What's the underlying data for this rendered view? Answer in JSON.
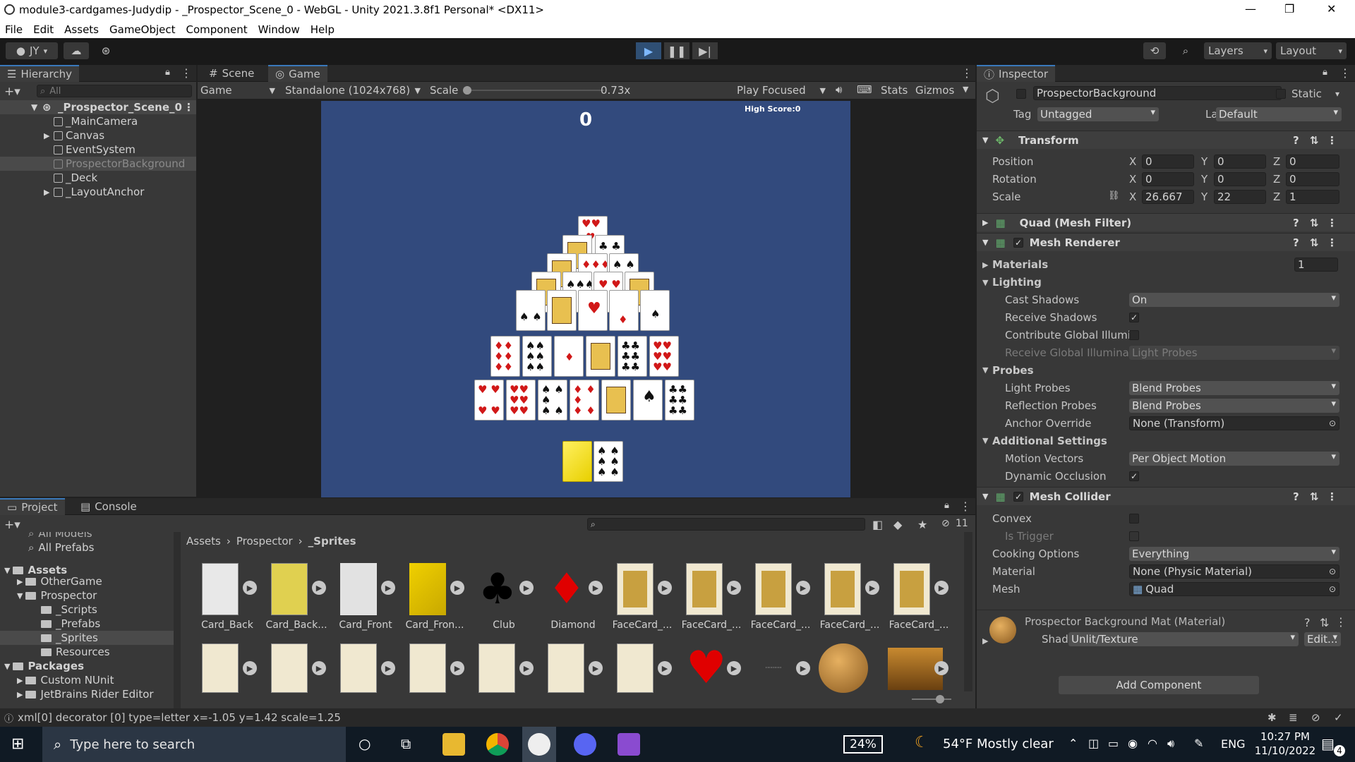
{
  "window": {
    "title": "module3-cardgames-Judydip - _Prospector_Scene_0 - WebGL - Unity 2021.3.8f1 Personal* <DX11>",
    "minimize": "—",
    "restore": "❐",
    "close": "✕"
  },
  "menu": [
    "File",
    "Edit",
    "Assets",
    "GameObject",
    "Component",
    "Window",
    "Help"
  ],
  "toolbar": {
    "account": "JY",
    "layers": "Layers",
    "layout": "Layout"
  },
  "hierarchy": {
    "tab": "Hierarchy",
    "search_placeholder": "All",
    "scene": "_Prospector_Scene_0",
    "items": [
      "_MainCamera",
      "Canvas",
      "EventSystem",
      "ProspectorBackground",
      "_Deck",
      "_LayoutAnchor"
    ]
  },
  "game": {
    "tabs": [
      "Scene",
      "Game"
    ],
    "display": "Game",
    "resolution": "Standalone (1024x768)",
    "scale_label": "Scale",
    "scale_value": "0.73x",
    "play_focused": "Play Focused",
    "stats": "Stats",
    "gizmos": "Gizmos",
    "score": "0",
    "high_score": "High Score:0"
  },
  "inspector": {
    "tab": "Inspector",
    "object_name": "ProspectorBackground",
    "static": "Static",
    "tag_label": "Tag",
    "tag": "Untagged",
    "layer_label": "Layer",
    "layer": "Default",
    "transform": {
      "title": "Transform",
      "position_label": "Position",
      "rotation_label": "Rotation",
      "scale_label": "Scale",
      "position": [
        "0",
        "0",
        "0"
      ],
      "rotation": [
        "0",
        "0",
        "0"
      ],
      "scale": [
        "26.667",
        "22",
        "1"
      ],
      "x": "X",
      "y": "Y",
      "z": "Z"
    },
    "mesh_filter": "Quad (Mesh Filter)",
    "mesh_renderer": {
      "title": "Mesh Renderer",
      "materials": "Materials",
      "materials_count": "1",
      "lighting": "Lighting",
      "cast_shadows_label": "Cast Shadows",
      "cast_shadows": "On",
      "receive_shadows": "Receive Shadows",
      "contribute_gi": "Contribute Global Illumir",
      "receive_gi_label": "Receive Global Illuminat",
      "receive_gi": "Light Probes",
      "probes": "Probes",
      "light_probes_label": "Light Probes",
      "light_probes": "Blend Probes",
      "reflection_probes_label": "Reflection Probes",
      "reflection_probes": "Blend Probes",
      "anchor_override_label": "Anchor Override",
      "anchor_override": "None (Transform)",
      "additional": "Additional Settings",
      "motion_vectors_label": "Motion Vectors",
      "motion_vectors": "Per Object Motion",
      "dynamic_occlusion": "Dynamic Occlusion"
    },
    "mesh_collider": {
      "title": "Mesh Collider",
      "convex": "Convex",
      "is_trigger": "Is Trigger",
      "cooking_label": "Cooking Options",
      "cooking": "Everything",
      "material_label": "Material",
      "material": "None (Physic Material)",
      "mesh_label": "Mesh",
      "mesh": "Quad"
    },
    "material": {
      "title": "Prospector Background Mat (Material)",
      "shader_label": "Shader",
      "shader": "Unlit/Texture",
      "edit": "Edit..."
    },
    "add_component": "Add Component"
  },
  "project": {
    "tabs": [
      "Project",
      "Console"
    ],
    "hidden_count": "11",
    "tree": {
      "all_models": "All Models",
      "all_prefabs": "All Prefabs",
      "assets": "Assets",
      "other_game": "OtherGame",
      "prospector": "Prospector",
      "scripts": "_Scripts",
      "prefabs": "_Prefabs",
      "sprites": "_Sprites",
      "resources": "Resources",
      "packages": "Packages",
      "custom_nunit": "Custom NUnit",
      "jetbrains": "JetBrains Rider Editor"
    },
    "breadcrumb": [
      "Assets",
      "Prospector",
      "_Sprites"
    ],
    "assets_row1": [
      "Card_Back",
      "Card_Back...",
      "Card_Front",
      "Card_Fron...",
      "Club",
      "Diamond",
      "FaceCard_...",
      "FaceCard_...",
      "FaceCard_...",
      "FaceCard_...",
      "FaceCard_..."
    ]
  },
  "status": {
    "message": "xml[0] decorator [0] type=letter x=-1.05 y=1.42 scale=1.25"
  },
  "taskbar": {
    "search_placeholder": "Type here to search",
    "battery": "24%",
    "weather": "54°F  Mostly clear",
    "lang": "ENG",
    "time": "10:27 PM",
    "date": "11/10/2022",
    "notif_count": "4"
  },
  "colors": {
    "accent": "#3a79bb",
    "game_bg": "#324a7d",
    "taskbar": "#101a24"
  }
}
